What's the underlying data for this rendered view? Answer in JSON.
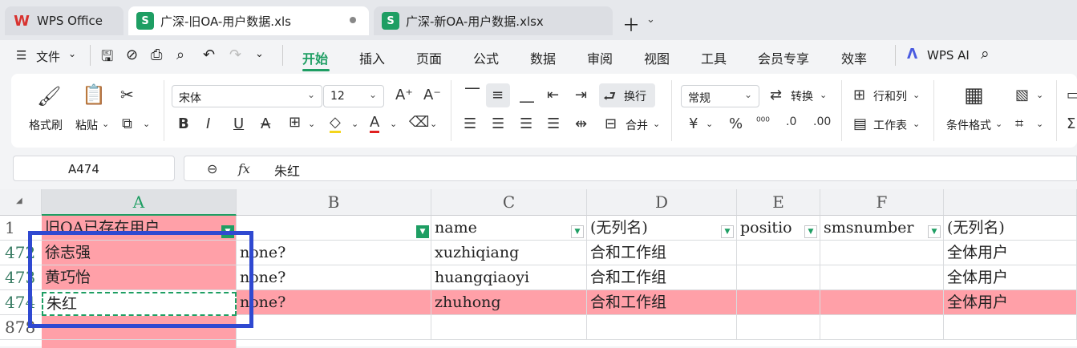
{
  "tabs": [
    {
      "label": "WPS Office",
      "icon": "wps-logo-icon"
    },
    {
      "label": "广深-旧OA-用户数据.xls",
      "icon": "sheet-icon"
    },
    {
      "label": "广深-新OA-用户数据.xlsx",
      "icon": "sheet-icon"
    }
  ],
  "menubar": {
    "file": "文件",
    "items": [
      "开始",
      "插入",
      "页面",
      "公式",
      "数据",
      "审阅",
      "视图",
      "工具",
      "会员专享",
      "效率"
    ],
    "wps_ai": "WPS AI"
  },
  "ribbon": {
    "format_painter": "格式刷",
    "paste": "粘贴",
    "font": "宋体",
    "font_size": "12",
    "wrap": "换行",
    "merge": "合并",
    "number_format": "常规",
    "convert": "转换",
    "rows_cols": "行和列",
    "worksheet": "工作表",
    "cond_format": "条件格式"
  },
  "formula_bar": {
    "name_box": "A474",
    "fx": "fx",
    "value": "朱红"
  },
  "grid": {
    "columns": [
      "A",
      "B",
      "C",
      "D",
      "E",
      "F"
    ],
    "header_row": {
      "row_number": "1",
      "cells": [
        "旧OA已存在用户",
        "",
        "name",
        "(无列名)",
        "positio",
        "smsnumber",
        "(无列名)"
      ]
    },
    "rows": [
      {
        "row_number": "472",
        "cells": [
          "徐志强",
          "none?",
          "xuzhiqiang",
          "合和工作组",
          "",
          "",
          "全体用户"
        ]
      },
      {
        "row_number": "473",
        "cells": [
          "黄巧怡",
          "none?",
          "huangqiaoyi",
          "合和工作组",
          "",
          "",
          "全体用户"
        ]
      },
      {
        "row_number": "474",
        "cells": [
          "朱红",
          "none?",
          "zhuhong",
          "合和工作组",
          "",
          "",
          "全体用户"
        ]
      }
    ],
    "empty_row_number": "878",
    "highlight_color": "#ffa0a8",
    "accent_color": "#1e9e63",
    "annotation_color": "#2f49d1"
  }
}
